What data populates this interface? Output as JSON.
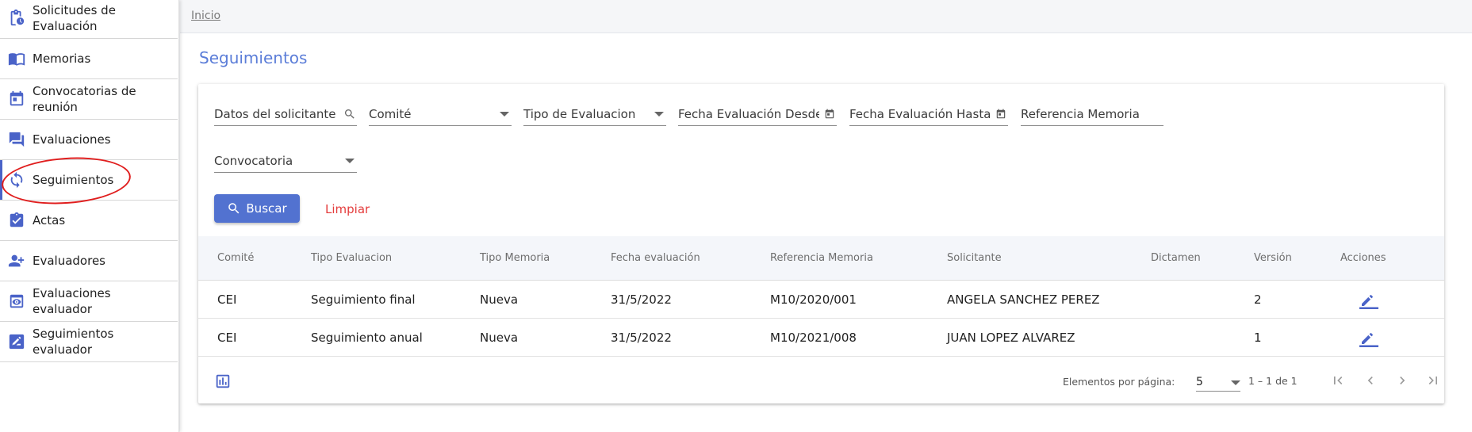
{
  "sidebar": {
    "items": [
      {
        "label": "Solicitudes de Evaluación",
        "icon": "clipboard-clock-icon"
      },
      {
        "label": "Memorias",
        "icon": "book-open-icon"
      },
      {
        "label": "Convocatorias de reunión",
        "icon": "calendar-icon"
      },
      {
        "label": "Evaluaciones",
        "icon": "chat-bubbles-icon"
      },
      {
        "label": "Seguimientos",
        "icon": "sync-icon",
        "active": true
      },
      {
        "label": "Actas",
        "icon": "clipboard-check-icon"
      },
      {
        "label": "Evaluadores",
        "icon": "person-add-icon"
      },
      {
        "label": "Evaluaciones evaluador",
        "icon": "eye-box-icon"
      },
      {
        "label": "Seguimientos evaluador",
        "icon": "signature-icon"
      }
    ]
  },
  "breadcrumb": "Inicio",
  "page_title": "Seguimientos",
  "filters": {
    "solicitante": "Datos del solicitante",
    "comite": "Comité",
    "tipo_evaluacion": "Tipo de Evaluacion",
    "fecha_desde": "Fecha Evaluación Desde",
    "fecha_hasta": "Fecha Evaluación Hasta",
    "referencia": "Referencia Memoria",
    "convocatoria": "Convocatoria"
  },
  "buttons": {
    "buscar": "Buscar",
    "limpiar": "Limpiar"
  },
  "table": {
    "columns": [
      "Comité",
      "Tipo Evaluacion",
      "Tipo Memoria",
      "Fecha evaluación",
      "Referencia Memoria",
      "Solicitante",
      "Dictamen",
      "Versión",
      "Acciones"
    ],
    "rows": [
      [
        "CEI",
        "Seguimiento final",
        "Nueva",
        "31/5/2022",
        "M10/2020/001",
        "ANGELA SANCHEZ PEREZ",
        "",
        "2"
      ],
      [
        "CEI",
        "Seguimiento anual",
        "Nueva",
        "31/5/2022",
        "M10/2021/008",
        "JUAN LOPEZ ALVAREZ",
        "",
        "1"
      ]
    ]
  },
  "paginator": {
    "label": "Elementos por página:",
    "page_size": "5",
    "range": "1 – 1 de 1"
  },
  "colors": {
    "accent": "#5272d0",
    "title": "#5b7dd8",
    "danger": "#e43c3c",
    "annotation": "#e01e1e"
  }
}
